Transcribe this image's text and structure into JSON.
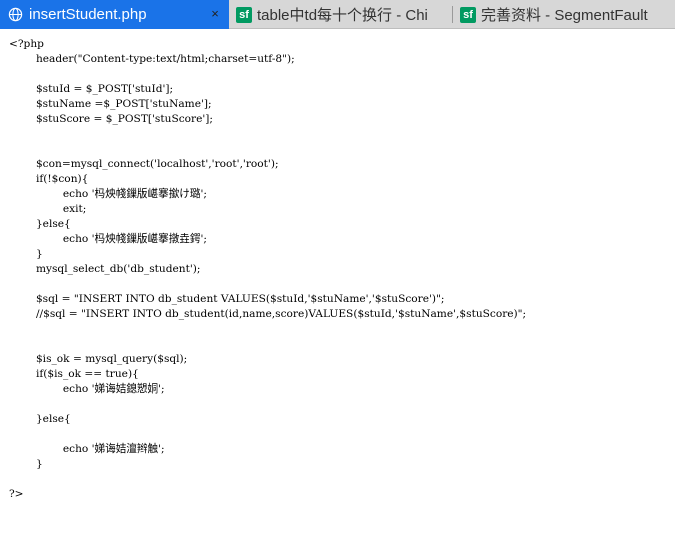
{
  "tabs": [
    {
      "title": "insertStudent.php",
      "icon": "globe-icon",
      "active": true,
      "close": "×"
    },
    {
      "title": "table中td每十个换行 - Chi",
      "icon": "segmentfault-icon",
      "active": false,
      "badge": "sf"
    },
    {
      "title": "完善资料 - SegmentFault",
      "icon": "segmentfault-icon",
      "active": false,
      "badge": "sf"
    }
  ],
  "colors": {
    "active_tab": "#1a73e8",
    "tab_bar": "#d7d7d7",
    "sf_brand": "#019a61"
  },
  "code_lines": [
    "<?php",
    "        header(\"Content-type:text/html;charset=utf-8\");",
    "",
    "        $stuId = $_POST['stuId'];",
    "        $stuName =$_POST['stuName'];",
    "        $stuScore = $_POST['stuScore'];",
    "",
    "",
    "        $con=mysql_connect('localhost','root','root');",
    "        if(!$con){",
    "                echo '杩炴帴鏁版嵁搴撳け璐';",
    "                exit;",
    "        }else{",
    "                echo '杩炴帴鏁版嵁搴撴垚鍔';",
    "        }",
    "        mysql_select_db('db_student');",
    "",
    "        $sql = \"INSERT INTO db_student VALUES($stuId,'$stuName','$stuScore')\";",
    "        //$sql = \"INSERT INTO db_student(id,name,score)VALUES($stuId,'$stuName',$stuScore)\";",
    "",
    "",
    "        $is_ok = mysql_query($sql);",
    "        if($is_ok == true){",
    "                echo '娣诲姞鎴愬姛';",
    "",
    "        }else{",
    "",
    "                echo '娣诲姞澶辫触';",
    "        }",
    "",
    "?>"
  ]
}
